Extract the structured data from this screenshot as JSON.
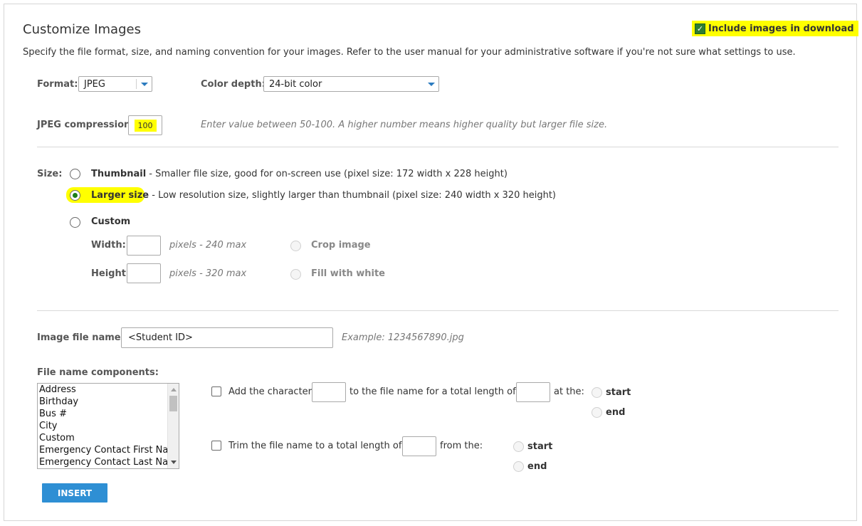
{
  "header": {
    "title": "Customize Images",
    "description": "Specify the file format, size, and naming convention for your images. Refer to the user manual for your administrative software if you're not sure what settings to use.",
    "include_images_label": "Include images in download",
    "include_images_checked": true,
    "highlight_color": "#ffff00"
  },
  "format": {
    "label": "Format:",
    "value": "JPEG",
    "color_depth_label": "Color depth:",
    "color_depth_value": "24-bit color"
  },
  "compression": {
    "label": "JPEG compression:",
    "value": "100",
    "hint": "Enter value between 50-100. A higher number means higher quality but larger file size."
  },
  "size": {
    "label": "Size:",
    "thumbnail_name": "Thumbnail",
    "thumbnail_desc": " - Smaller file size, good for on-screen use (pixel size: 172 width x 228 height)",
    "larger_name": "Larger size",
    "larger_desc": " - Low resolution size, slightly larger than thumbnail (pixel size: 240 width x 320 height)",
    "custom_name": "Custom",
    "selected": "Larger size",
    "width_label": "Width:",
    "width_hint": "pixels - 240 max",
    "height_label": "Height:",
    "height_hint": "pixels - 320 max",
    "crop_label": "Crop image",
    "fill_label": "Fill with white"
  },
  "filename": {
    "label": "Image file name:",
    "value": "<Student ID>",
    "example": "Example: 1234567890.jpg",
    "components_label": "File name components:",
    "components": [
      "Address",
      "Birthday",
      "Bus #",
      "City",
      "Custom",
      "Emergency Contact First Nar",
      "Emergency Contact Last Nan"
    ],
    "add_char_label": "Add the character",
    "to_file_label": "to the file name for a total length of",
    "at_the_label": "at the:",
    "start_label": "start",
    "end_label": "end",
    "trim_label": "Trim the file name to a total length of",
    "from_the_label": "from the:",
    "insert_button": "INSERT",
    "button_color": "#2e8fd4"
  }
}
